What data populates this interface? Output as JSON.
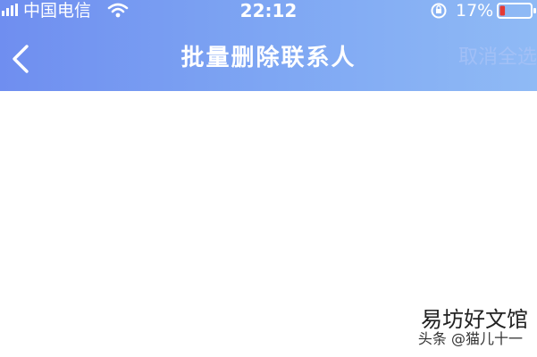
{
  "status_bar": {
    "carrier": "中国电信",
    "time": "22:12",
    "battery_percent": "17%",
    "icons": [
      "signal-icon",
      "wifi-icon",
      "orientation-lock-icon",
      "battery-low-icon"
    ],
    "battery_level": 0.17
  },
  "nav": {
    "title": "批量删除联系人",
    "back_icon": "chevron-left-icon",
    "cancel_select_all": "取消全选"
  },
  "colors": {
    "header_gradient_start": "#6f8ef0",
    "header_gradient_end": "#8fbaf5",
    "battery_low": "#e53935",
    "background": "#ffffff"
  },
  "watermark": {
    "site": "易坊好文馆",
    "author": "头条 @猫儿十一"
  }
}
